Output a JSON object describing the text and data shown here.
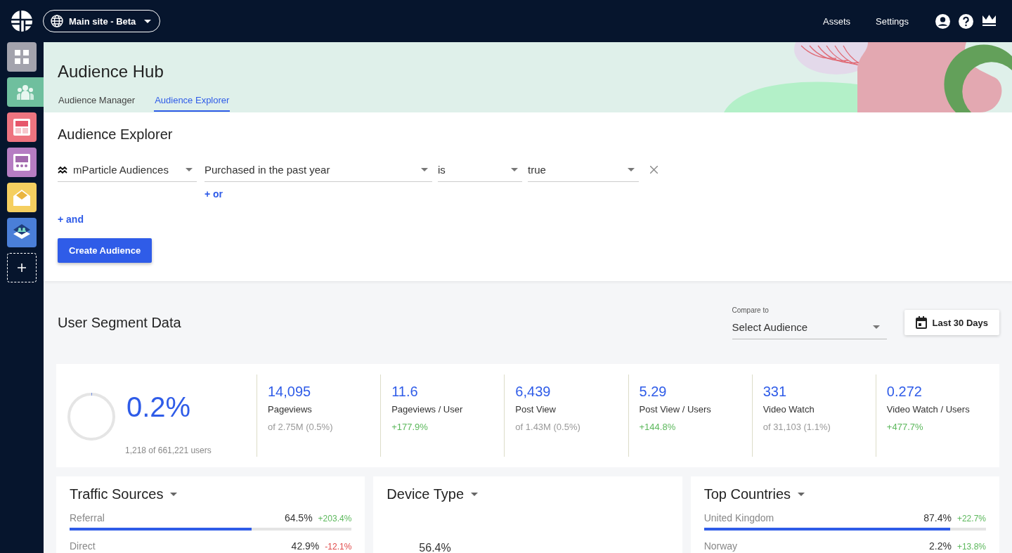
{
  "top_bar": {
    "site_selector": "Main site - Beta",
    "links": [
      "Assets",
      "Settings"
    ]
  },
  "sidebar": {
    "items": [
      {
        "kind": "grid",
        "color": "#a3a3ad",
        "selected": false
      },
      {
        "kind": "people",
        "color": "#6fbf9e",
        "selected": true
      },
      {
        "kind": "layout",
        "color": "#ee7480",
        "selected": false
      },
      {
        "kind": "panel",
        "color": "#b67dc3",
        "selected": false
      },
      {
        "kind": "mail",
        "color": "#f5cf60",
        "selected": false
      },
      {
        "kind": "layers",
        "color": "#4a7fd8",
        "selected": false
      },
      {
        "kind": "add",
        "selected": false
      }
    ]
  },
  "header": {
    "title": "Audience Hub",
    "tabs": [
      {
        "label": "Audience Manager",
        "selected": false
      },
      {
        "label": "Audience Explorer",
        "selected": true
      }
    ]
  },
  "explorer": {
    "title": "Audience Explorer",
    "filter": {
      "source": "mParticle Audiences",
      "attribute": "Purchased in the past year",
      "operator": "is",
      "value": "true"
    },
    "or_link": "+ or",
    "and_link": "+ and",
    "create_button": "Create Audience"
  },
  "segment": {
    "title": "User Segment Data",
    "compare": {
      "label": "Compare to",
      "value": "Select Audience"
    },
    "date_button": "Last 30 Days"
  },
  "summary": {
    "percent": "0.2%",
    "level": 0.002,
    "users": "1,218 of 661,221 users"
  },
  "metrics": [
    {
      "value": "14,095",
      "label": "Pageviews",
      "detail": "of 2.75M (0.5%)",
      "kind": "share"
    },
    {
      "value": "11.6",
      "label": "Pageviews / User",
      "detail": "+177.9%",
      "kind": "change"
    },
    {
      "value": "6,439",
      "label": "Post View",
      "detail": "of 1.43M (0.5%)",
      "kind": "share"
    },
    {
      "value": "5.29",
      "label": "Post View / Users",
      "detail": "+144.8%",
      "kind": "change"
    },
    {
      "value": "331",
      "label": "Video Watch",
      "detail": "of 31,103 (1.1%)",
      "kind": "share"
    },
    {
      "value": "0.272",
      "label": "Video Watch / Users",
      "detail": "+477.7%",
      "kind": "change"
    }
  ],
  "cards": [
    {
      "title": "Traffic Sources",
      "rows": [
        {
          "label": "Referral",
          "value": "64.5%",
          "change": "+203.4%",
          "kind": "up",
          "level": 0.645
        },
        {
          "label": "Direct",
          "value": "42.9%",
          "change": "-12.1%",
          "kind": "down"
        }
      ]
    },
    {
      "title": "Device Type",
      "rows": [
        {
          "value": "56.4%"
        }
      ]
    },
    {
      "title": "Top Countries",
      "rows": [
        {
          "label": "United Kingdom",
          "value": "87.4%",
          "change": "+22.7%",
          "kind": "up",
          "level": 0.874
        },
        {
          "label": "Norway",
          "value": "2.2%",
          "change": "+13.8%",
          "kind": "up"
        }
      ]
    }
  ]
}
